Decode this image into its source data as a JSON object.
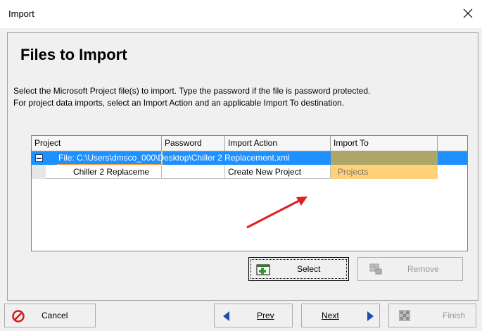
{
  "window": {
    "title": "Import"
  },
  "page": {
    "heading": "Files to Import",
    "description_line1": "Select the Microsoft Project file(s) to import.  Type the password if the file is password protected.",
    "description_line2": "For project data imports, select an Import Action and an applicable Import To destination."
  },
  "grid": {
    "columns": [
      "Project",
      "Password",
      "Import Action",
      "Import To"
    ],
    "file_row": {
      "text": "File: C:\\Users\\dmsco_000\\Desktop\\Chiller 2 Replacement.xml"
    },
    "project_row": {
      "project": "Chiller 2 Replaceme",
      "password": "",
      "import_action": "Create New Project",
      "import_to": "Projects"
    }
  },
  "buttons": {
    "select": "Select",
    "remove": "Remove",
    "cancel": "Cancel",
    "prev": "Prev",
    "next": "Next",
    "finish": "Finish"
  },
  "colors": {
    "selection": "#1e90ff",
    "import_to_highlight": "#ffd27a",
    "annotation_arrow": "#e02020"
  },
  "icons": {
    "close": "close-icon",
    "select": "add-file-icon",
    "remove": "remove-grid-icon",
    "cancel": "cancel-icon",
    "prev": "triangle-left-icon",
    "next": "triangle-right-icon",
    "finish": "finish-flag-icon"
  }
}
